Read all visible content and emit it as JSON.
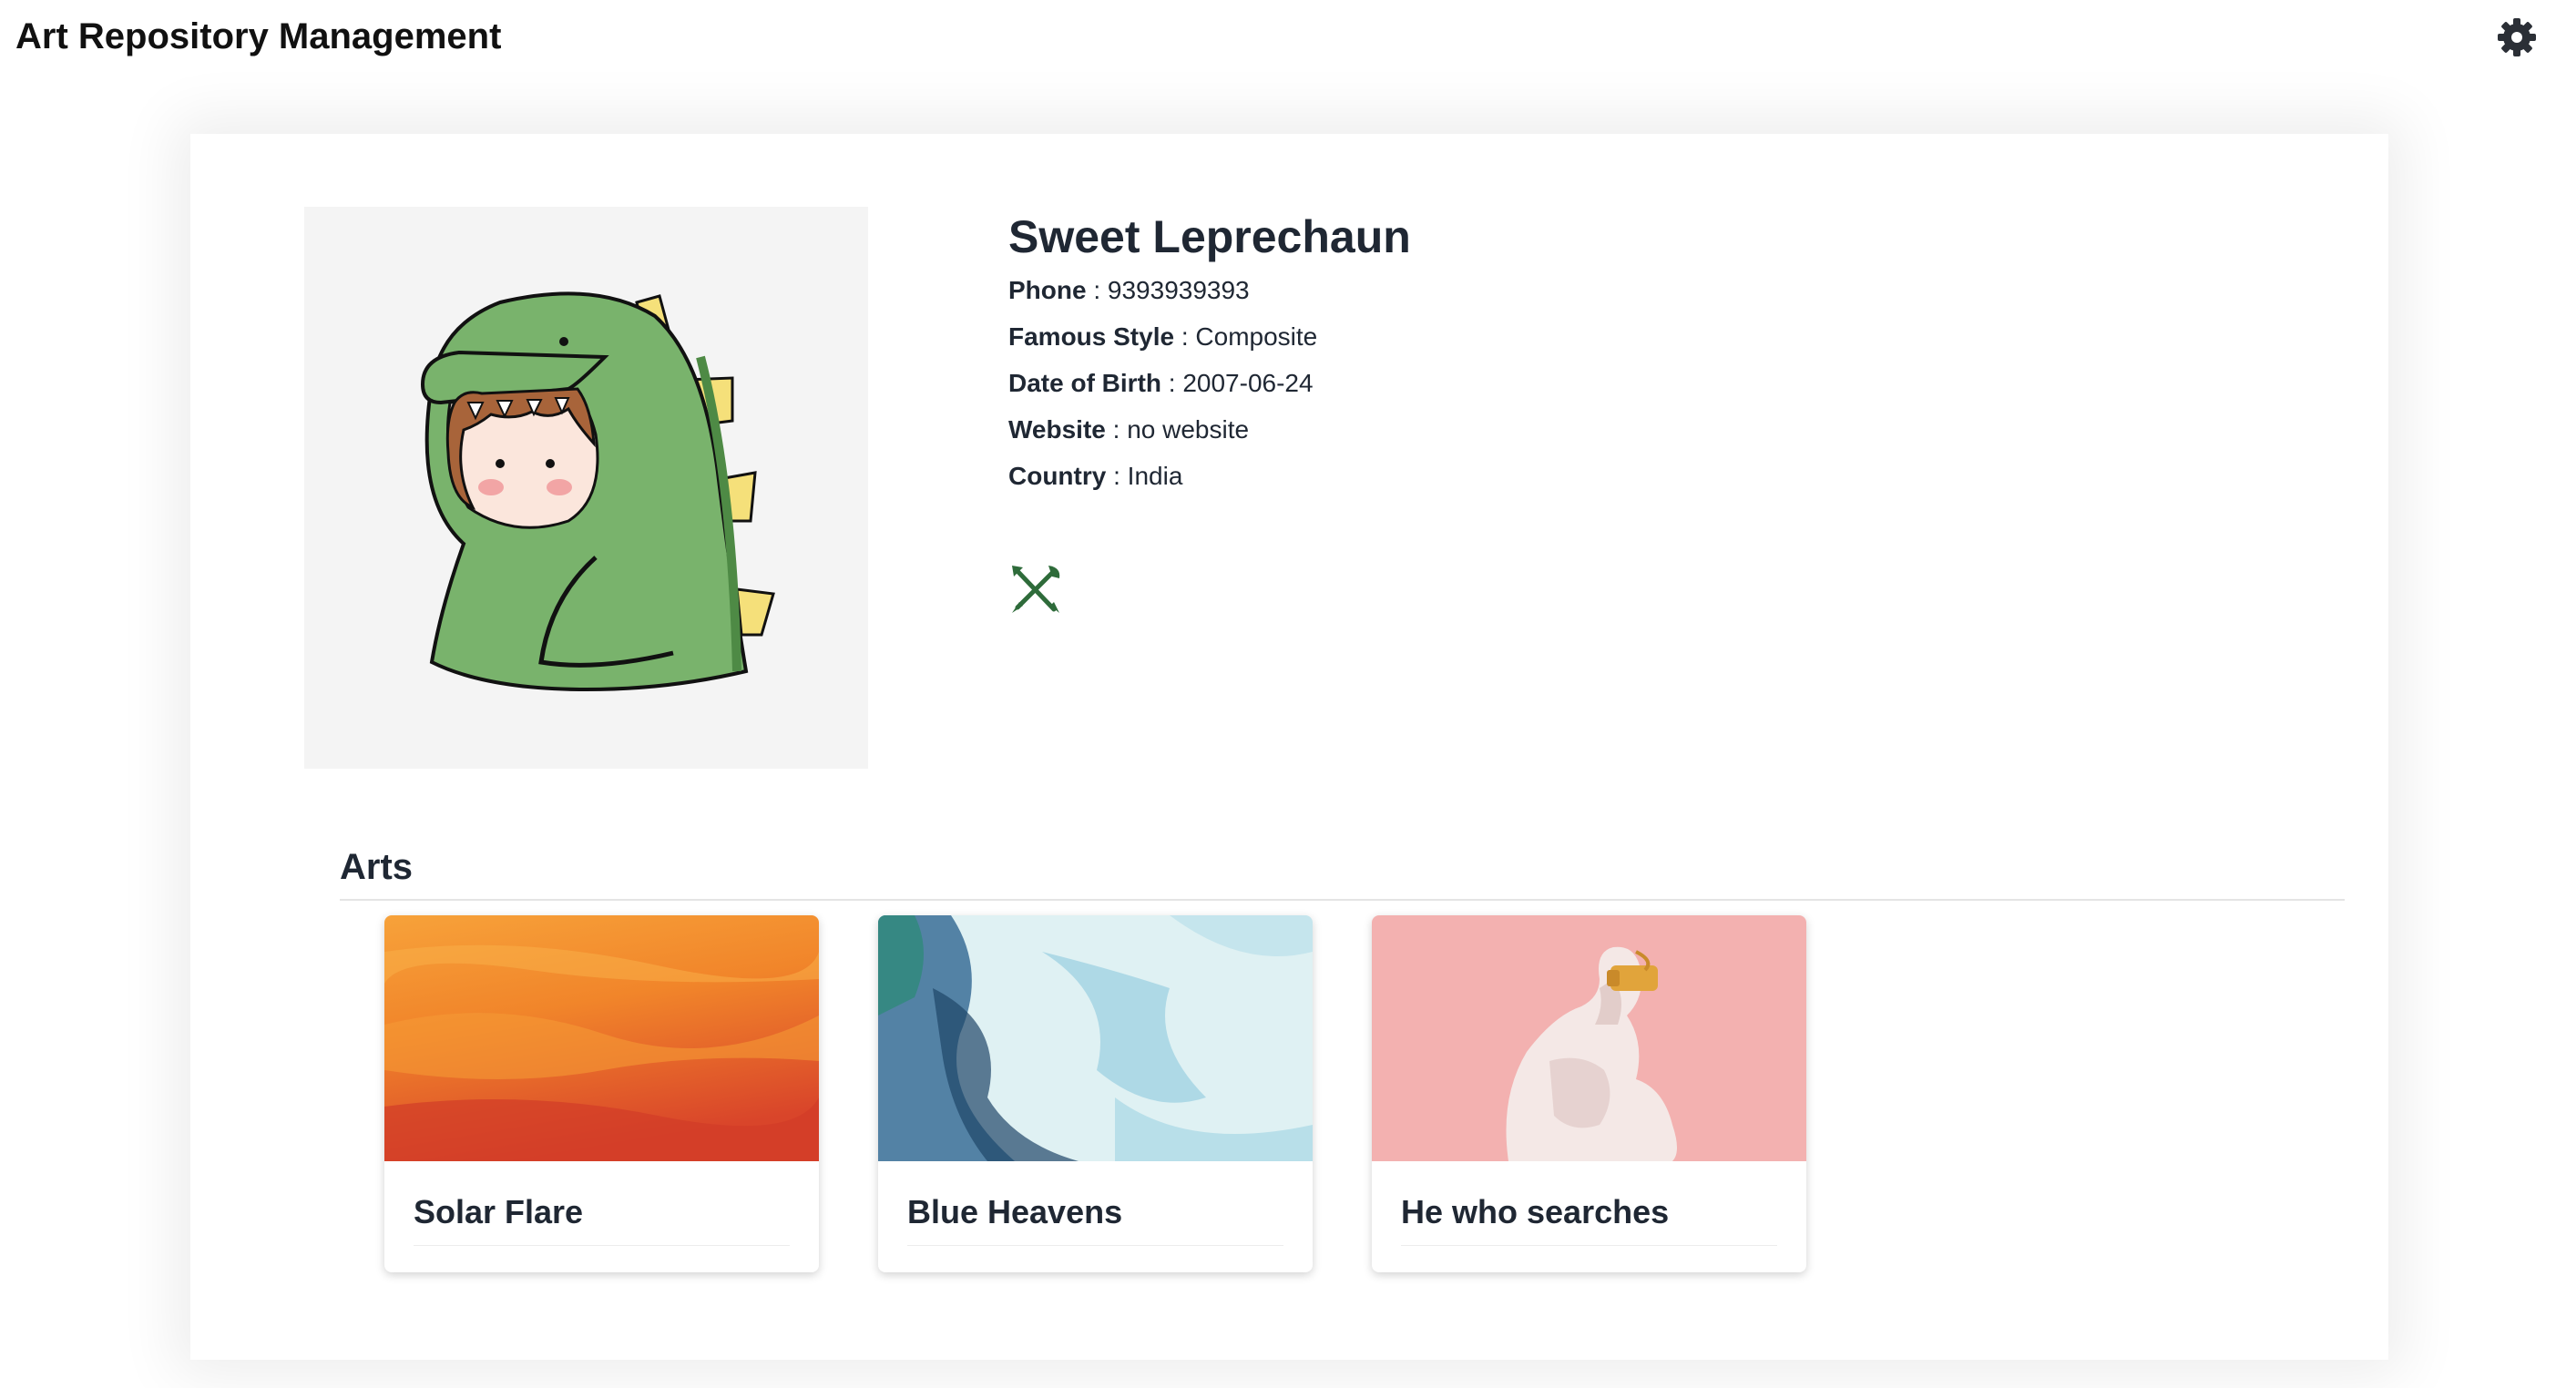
{
  "app": {
    "title": "Art Repository Management"
  },
  "header": {
    "settings_icon": "gear-icon"
  },
  "profile": {
    "name": "Sweet Leprechaun",
    "fields": [
      {
        "label": "Phone",
        "value": "9393939393"
      },
      {
        "label": "Famous Style",
        "value": "Composite"
      },
      {
        "label": "Date of Birth",
        "value": "2007-06-24"
      },
      {
        "label": "Website",
        "value": "no website"
      },
      {
        "label": "Country",
        "value": "India"
      }
    ],
    "edit_icon": "edit-pencil-brush-icon",
    "edit_icon_color": "#2e6b3a"
  },
  "arts": {
    "heading": "Arts",
    "items": [
      {
        "title": "Solar Flare",
        "image": "orange-abstract-paint"
      },
      {
        "title": "Blue Heavens",
        "image": "blue-ink-marble"
      },
      {
        "title": "He who searches",
        "image": "thinker-statue-vr-headset"
      }
    ]
  },
  "colors": {
    "text": "#1f2733",
    "avatar_bg": "#f4f4f4",
    "accent_green": "#2e6b3a"
  }
}
